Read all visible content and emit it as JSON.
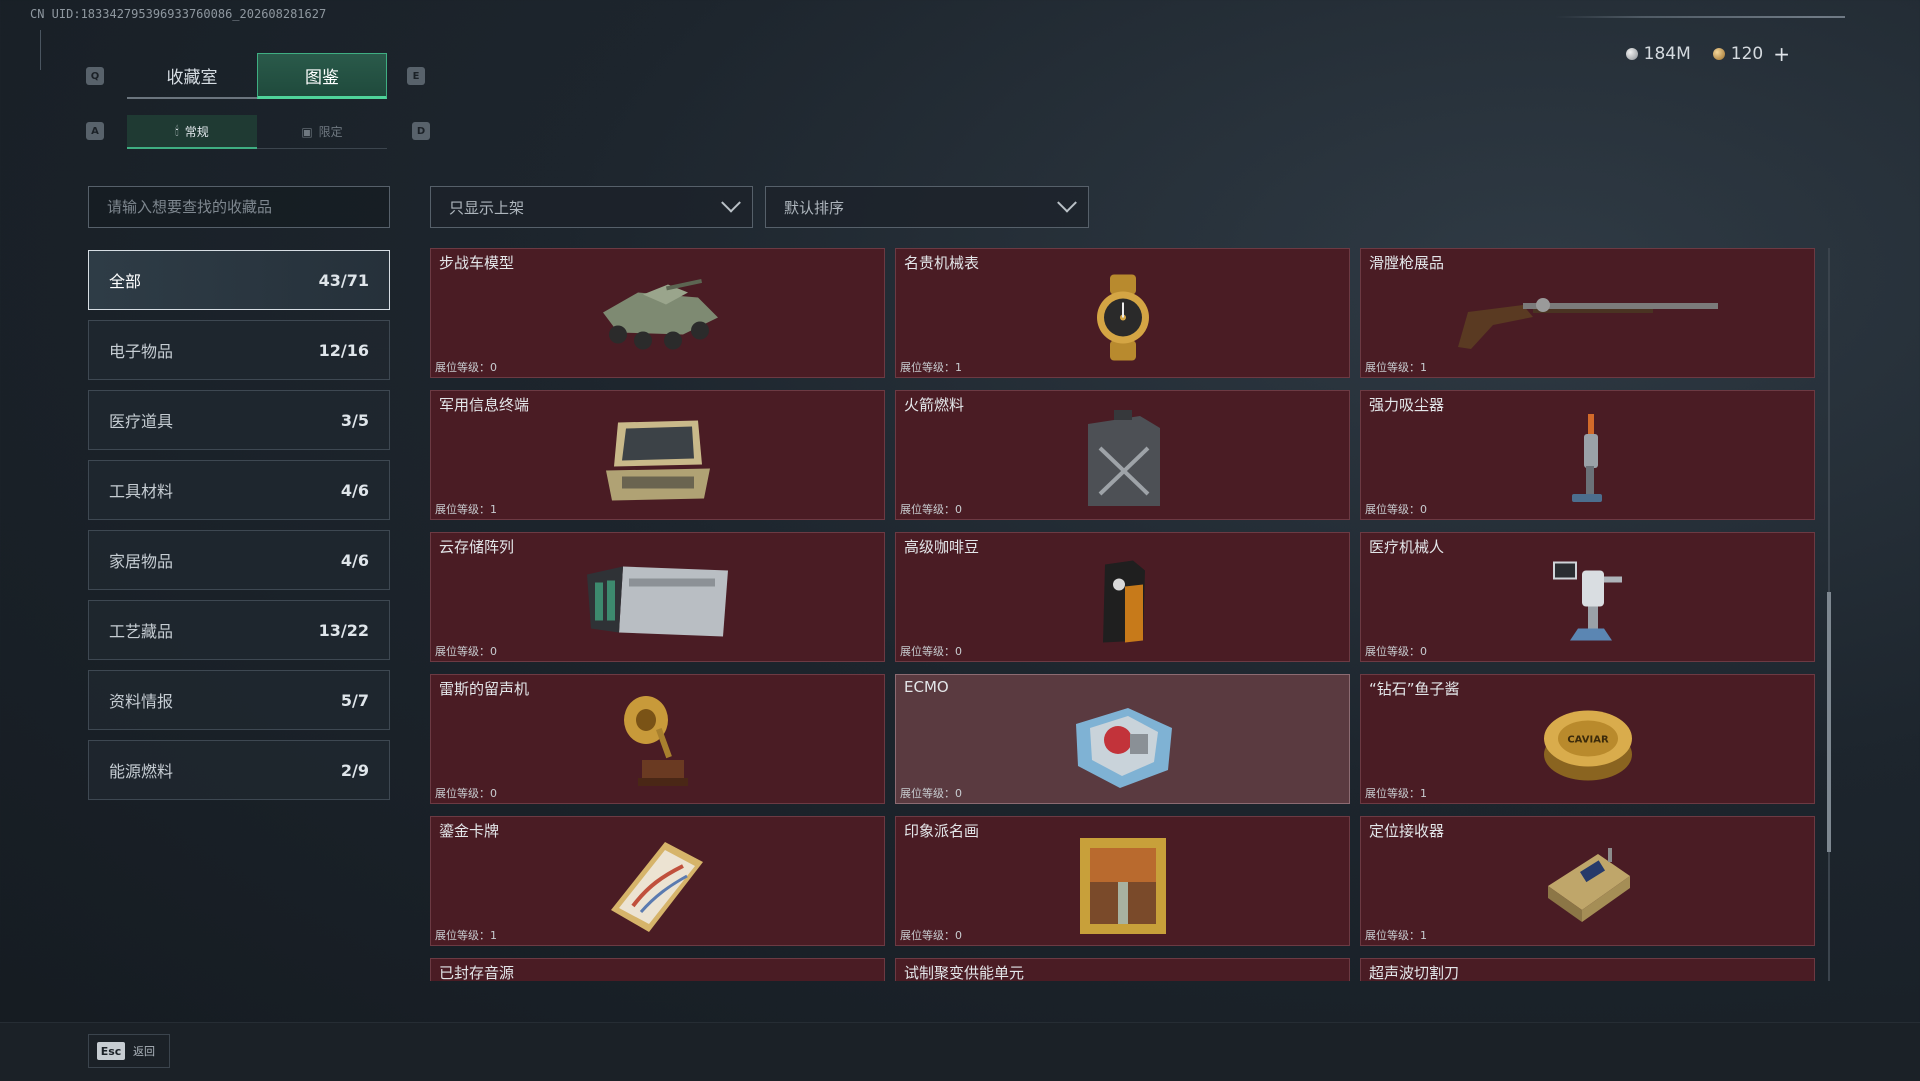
{
  "uid_text": "CN UID:183342795396933760086_202608281627",
  "currency": {
    "silver": "184M",
    "gold": "120",
    "plus": "+"
  },
  "keys": {
    "tab_prev": "Q",
    "tab_next": "E",
    "sub_prev": "A",
    "sub_next": "D"
  },
  "main_tabs": [
    {
      "label": "收藏室",
      "active": false
    },
    {
      "label": "图鉴",
      "active": true
    }
  ],
  "sub_tabs": [
    {
      "label": "常规",
      "icon": "flame-icon",
      "active": true
    },
    {
      "label": "限定",
      "icon": "image-icon",
      "active": false
    }
  ],
  "search": {
    "placeholder": "请输入想要查找的收藏品",
    "value": ""
  },
  "filters": {
    "display": "只显示上架",
    "sort": "默认排序"
  },
  "categories": [
    {
      "label": "全部",
      "count": "43/71",
      "active": true
    },
    {
      "label": "电子物品",
      "count": "12/16"
    },
    {
      "label": "医疗道具",
      "count": "3/5"
    },
    {
      "label": "工具材料",
      "count": "4/6"
    },
    {
      "label": "家居物品",
      "count": "4/6"
    },
    {
      "label": "工艺藏品",
      "count": "13/22"
    },
    {
      "label": "资料情报",
      "count": "5/7"
    },
    {
      "label": "能源燃料",
      "count": "2/9"
    }
  ],
  "items": [
    {
      "name": "步战车模型",
      "level": "展位等级：0",
      "icon": "ifv-model-icon"
    },
    {
      "name": "名贵机械表",
      "level": "展位等级：1",
      "icon": "wristwatch-icon"
    },
    {
      "name": "滑膛枪展品",
      "level": "展位等级：1",
      "icon": "musket-icon"
    },
    {
      "name": "军用信息终端",
      "level": "展位等级：1",
      "icon": "military-terminal-icon"
    },
    {
      "name": "火箭燃料",
      "level": "展位等级：0",
      "icon": "fuel-canister-icon"
    },
    {
      "name": "强力吸尘器",
      "level": "展位等级：0",
      "icon": "vacuum-icon"
    },
    {
      "name": "云存储阵列",
      "level": "展位等级：0",
      "icon": "storage-array-icon"
    },
    {
      "name": "高级咖啡豆",
      "level": "展位等级：0",
      "icon": "coffee-bag-icon"
    },
    {
      "name": "医疗机械人",
      "level": "展位等级：0",
      "icon": "medical-robot-icon"
    },
    {
      "name": "雷斯的留声机",
      "level": "展位等级：0",
      "icon": "gramophone-icon"
    },
    {
      "name": "ECMO",
      "level": "展位等级：0",
      "icon": "ecmo-icon",
      "highlight": true
    },
    {
      "name": "“钻石”鱼子酱",
      "level": "展位等级：1",
      "icon": "caviar-tin-icon",
      "tin_label": "CAVIAR"
    },
    {
      "name": "鎏金卡牌",
      "level": "展位等级：1",
      "icon": "gilded-card-icon"
    },
    {
      "name": "印象派名画",
      "level": "展位等级：0",
      "icon": "framed-painting-icon"
    },
    {
      "name": "定位接收器",
      "level": "展位等级：1",
      "icon": "locator-receiver-icon"
    },
    {
      "name": "已封存音源",
      "level": "",
      "icon": "sealed-audio-icon",
      "cut": true
    },
    {
      "name": "试制聚变供能单元",
      "level": "",
      "icon": "fusion-unit-icon",
      "cut": true
    },
    {
      "name": "超声波切割刀",
      "level": "",
      "icon": "ultrasonic-cutter-icon",
      "cut": true
    }
  ],
  "bottom": {
    "esc_key": "Esc",
    "esc_label": "返回"
  }
}
